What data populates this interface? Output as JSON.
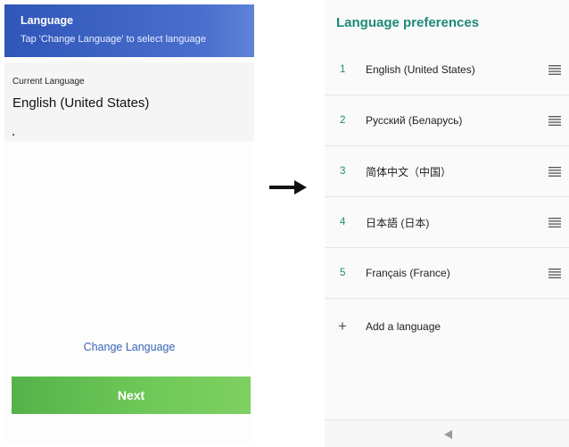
{
  "left_screen": {
    "header_title": "Language",
    "header_subtitle": "Tap 'Change Language' to select language",
    "current_label": "Current Language",
    "current_value": "English (United States)",
    "change_language_link": "Change Language",
    "next_button": "Next"
  },
  "right_screen": {
    "title": "Language preferences",
    "languages": [
      {
        "num": "1",
        "name": "English (United States)"
      },
      {
        "num": "2",
        "name": "Русский (Беларусь)"
      },
      {
        "num": "3",
        "name": "简体中文（中国）"
      },
      {
        "num": "4",
        "name": "日本語 (日本)"
      },
      {
        "num": "5",
        "name": "Français (France)"
      }
    ],
    "add_language": "Add a language",
    "add_icon": "+"
  },
  "colors": {
    "header_blue": "#2f56b8",
    "accent_teal": "#1e8a78",
    "link_blue": "#3a63b8",
    "next_green": "#6dc857"
  },
  "icons": [
    "arrow-right-icon",
    "drag-handle-icon",
    "plus-icon",
    "back-triangle-icon"
  ]
}
